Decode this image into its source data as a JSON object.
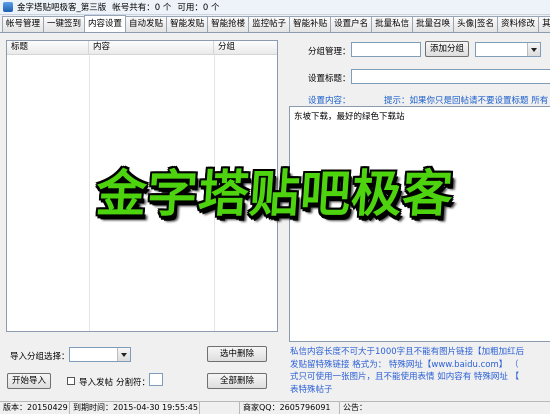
{
  "window": {
    "title": "金字塔贴吧极客_第三版",
    "account_total": "帐号共有：0 个",
    "account_usable": "可用：0 个"
  },
  "tabs": [
    "帐号管理",
    "一键签到",
    "内容设置",
    "自动发贴",
    "智能发贴",
    "智能抢楼",
    "监控帖子",
    "智能补贴",
    "设置户名",
    "批量私信",
    "批量召唤",
    "头像|签名",
    "资料修改",
    "其他"
  ],
  "active_tab": "内容设置",
  "list": {
    "columns": [
      "标题",
      "内容",
      "分组"
    ],
    "rows": []
  },
  "group_manage": {
    "label": "分组管理：",
    "value": "",
    "add_button": "添加分组",
    "select_value": ""
  },
  "set_title": {
    "label": "设置标题：",
    "value": ""
  },
  "set_content": {
    "label": "设置内容：",
    "hint": "提示：如果你只是回帖请不要设置标题 所有（",
    "text": "东坡下载，最好的绿色下载站"
  },
  "import": {
    "group_select_label": "导入分组选择：",
    "group_select_value": "",
    "delete_selected": "选中删除",
    "start_import": "开始导入",
    "import_post_label": "导入发帖",
    "separator_label": "分割符：",
    "separator_value": "",
    "delete_all": "全部删除"
  },
  "note_lines": [
    "私信内容长度不可大于1000字且不能有图片链接【加粗加红后",
    "发贴留特殊链接  格式为：  特殊网址【www.baidu.com】  （",
    "式只可使用一张图片，且不能使用表情  如内容有 特殊网址 【",
    "表特殊帖子"
  ],
  "status": {
    "version_label": "版本：",
    "version_value": "20150429",
    "expire_label": "到期时间：",
    "expire_value": "2015-04-30 19:55:45",
    "merchant_label": "商家QQ：",
    "merchant_value": "2605796091",
    "notice_label": "公告："
  },
  "banner_text": "金字塔贴吧极客",
  "colors": {
    "banner": "#4dd40f",
    "hint": "#1a5ecc",
    "note": "#2b5fd6"
  }
}
